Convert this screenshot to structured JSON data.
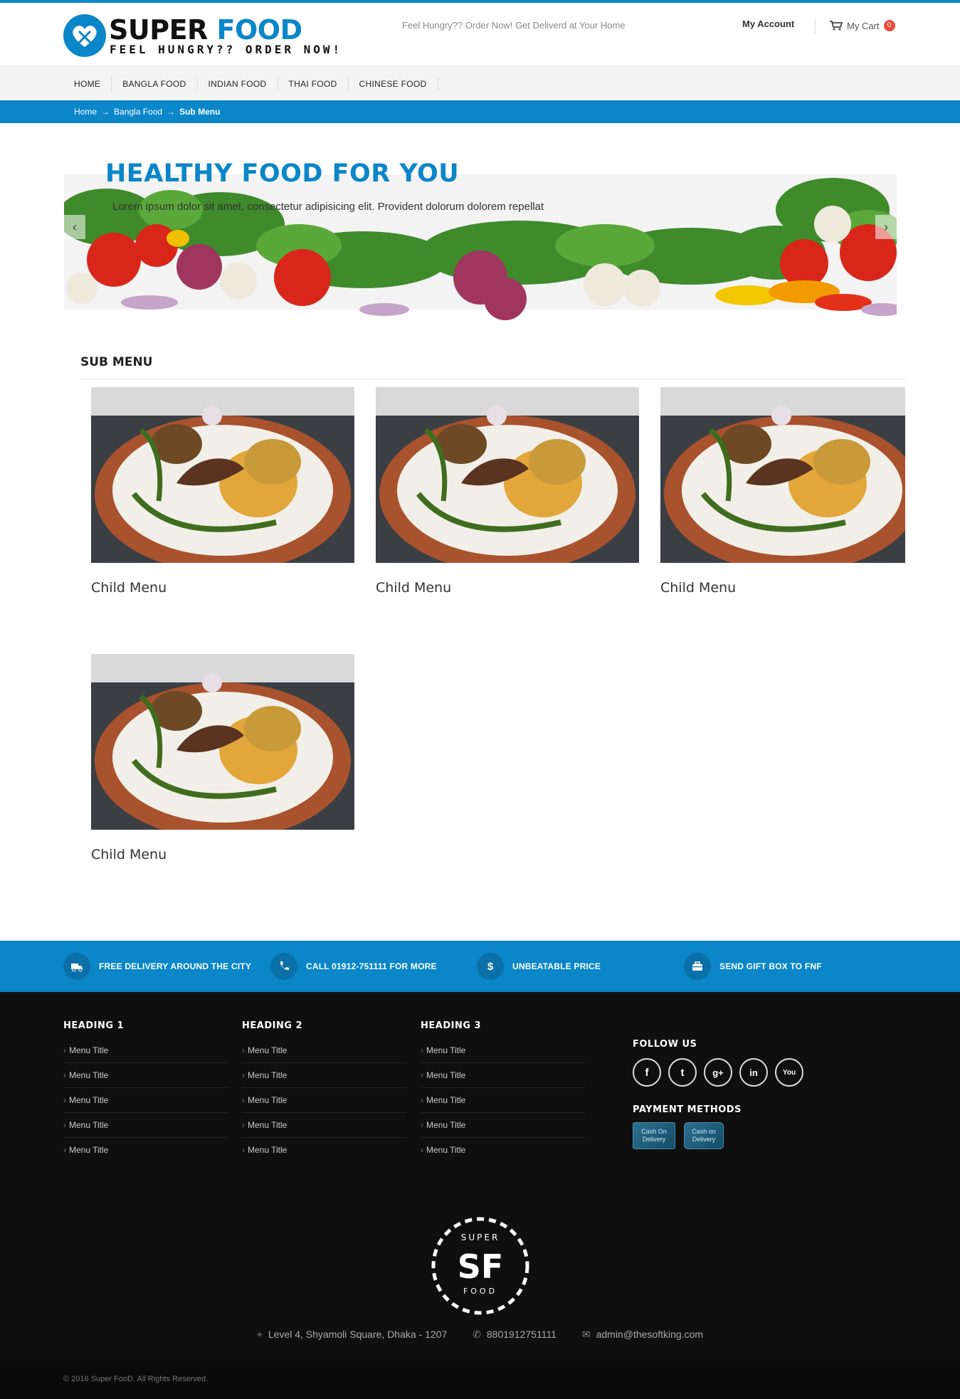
{
  "header": {
    "logo_word1": "SUPER",
    "logo_word2": "FOOD",
    "logo_tagline": "FEEL HUNGRY?? ORDER NOW!",
    "tagline": "Feel Hungry?? Order Now! Get Deliverd at Your Home",
    "account_label": "My Account",
    "cart_label": "My Cart",
    "cart_count": "0"
  },
  "nav": {
    "items": [
      "HOME",
      "BANGLA FOOD",
      "INDIAN FOOD",
      "THAI FOOD",
      "CHINESE FOOD"
    ]
  },
  "breadcrumb": {
    "items": [
      "Home",
      "Bangla Food",
      "Sub Menu"
    ],
    "separator": "→"
  },
  "banner": {
    "title": "HEALTHY FOOD FOR YOU",
    "text": "Lorem ipsum dolor sit amet, consectetur adipisicing elit. Provident dolorum dolorem repellat",
    "prev": "‹",
    "next": "›"
  },
  "submenu": {
    "title": "SUB MENU",
    "cards": [
      {
        "label": "Child Menu"
      },
      {
        "label": "Child Menu"
      },
      {
        "label": "Child Menu"
      },
      {
        "label": "Child Menu"
      }
    ]
  },
  "features": [
    {
      "icon": "truck-icon",
      "text": "FREE DELIVERY AROUND THE CITY"
    },
    {
      "icon": "phone-icon",
      "text": "CALL 01912-751111 FOR MORE"
    },
    {
      "icon": "dollar-icon",
      "text": "UNBEATABLE PRICE"
    },
    {
      "icon": "gift-icon",
      "text": "SEND GIFT BOX TO FNF"
    }
  ],
  "footer": {
    "columns": [
      {
        "heading": "HEADING 1",
        "items": [
          "Menu Title",
          "Menu Title",
          "Menu Title",
          "Menu Title",
          "Menu Title"
        ]
      },
      {
        "heading": "HEADING 2",
        "items": [
          "Menu Title",
          "Menu Title",
          "Menu Title",
          "Menu Title",
          "Menu Title"
        ]
      },
      {
        "heading": "HEADING 3",
        "items": [
          "Menu Title",
          "Menu Title",
          "Menu Title",
          "Menu Title",
          "Menu Title"
        ]
      }
    ],
    "follow_heading": "FOLLOW US",
    "socials": [
      {
        "name": "facebook-icon",
        "glyph": "f"
      },
      {
        "name": "twitter-icon",
        "glyph": "t"
      },
      {
        "name": "google-plus-icon",
        "glyph": "g+"
      },
      {
        "name": "linkedin-icon",
        "glyph": "in"
      },
      {
        "name": "youtube-icon",
        "glyph": "You"
      }
    ],
    "payment_heading": "PAYMENT METHODS",
    "payments": [
      "Cash On Delivery",
      "Cash on Delivery"
    ],
    "seal": {
      "top": "SUPER",
      "mid": "SF",
      "bottom": "FOOD"
    },
    "address": "Level 4, Shyamoli Square, Dhaka - 1207",
    "phone": "8801912751111",
    "email": "admin@thesoftking.com",
    "copyright": "© 2016 Super FooD. All Rights Reserved."
  },
  "colors": {
    "brand_blue": "#0a86c9",
    "footer_bg": "#0f0f0f",
    "badge_red": "#e74c3c"
  }
}
